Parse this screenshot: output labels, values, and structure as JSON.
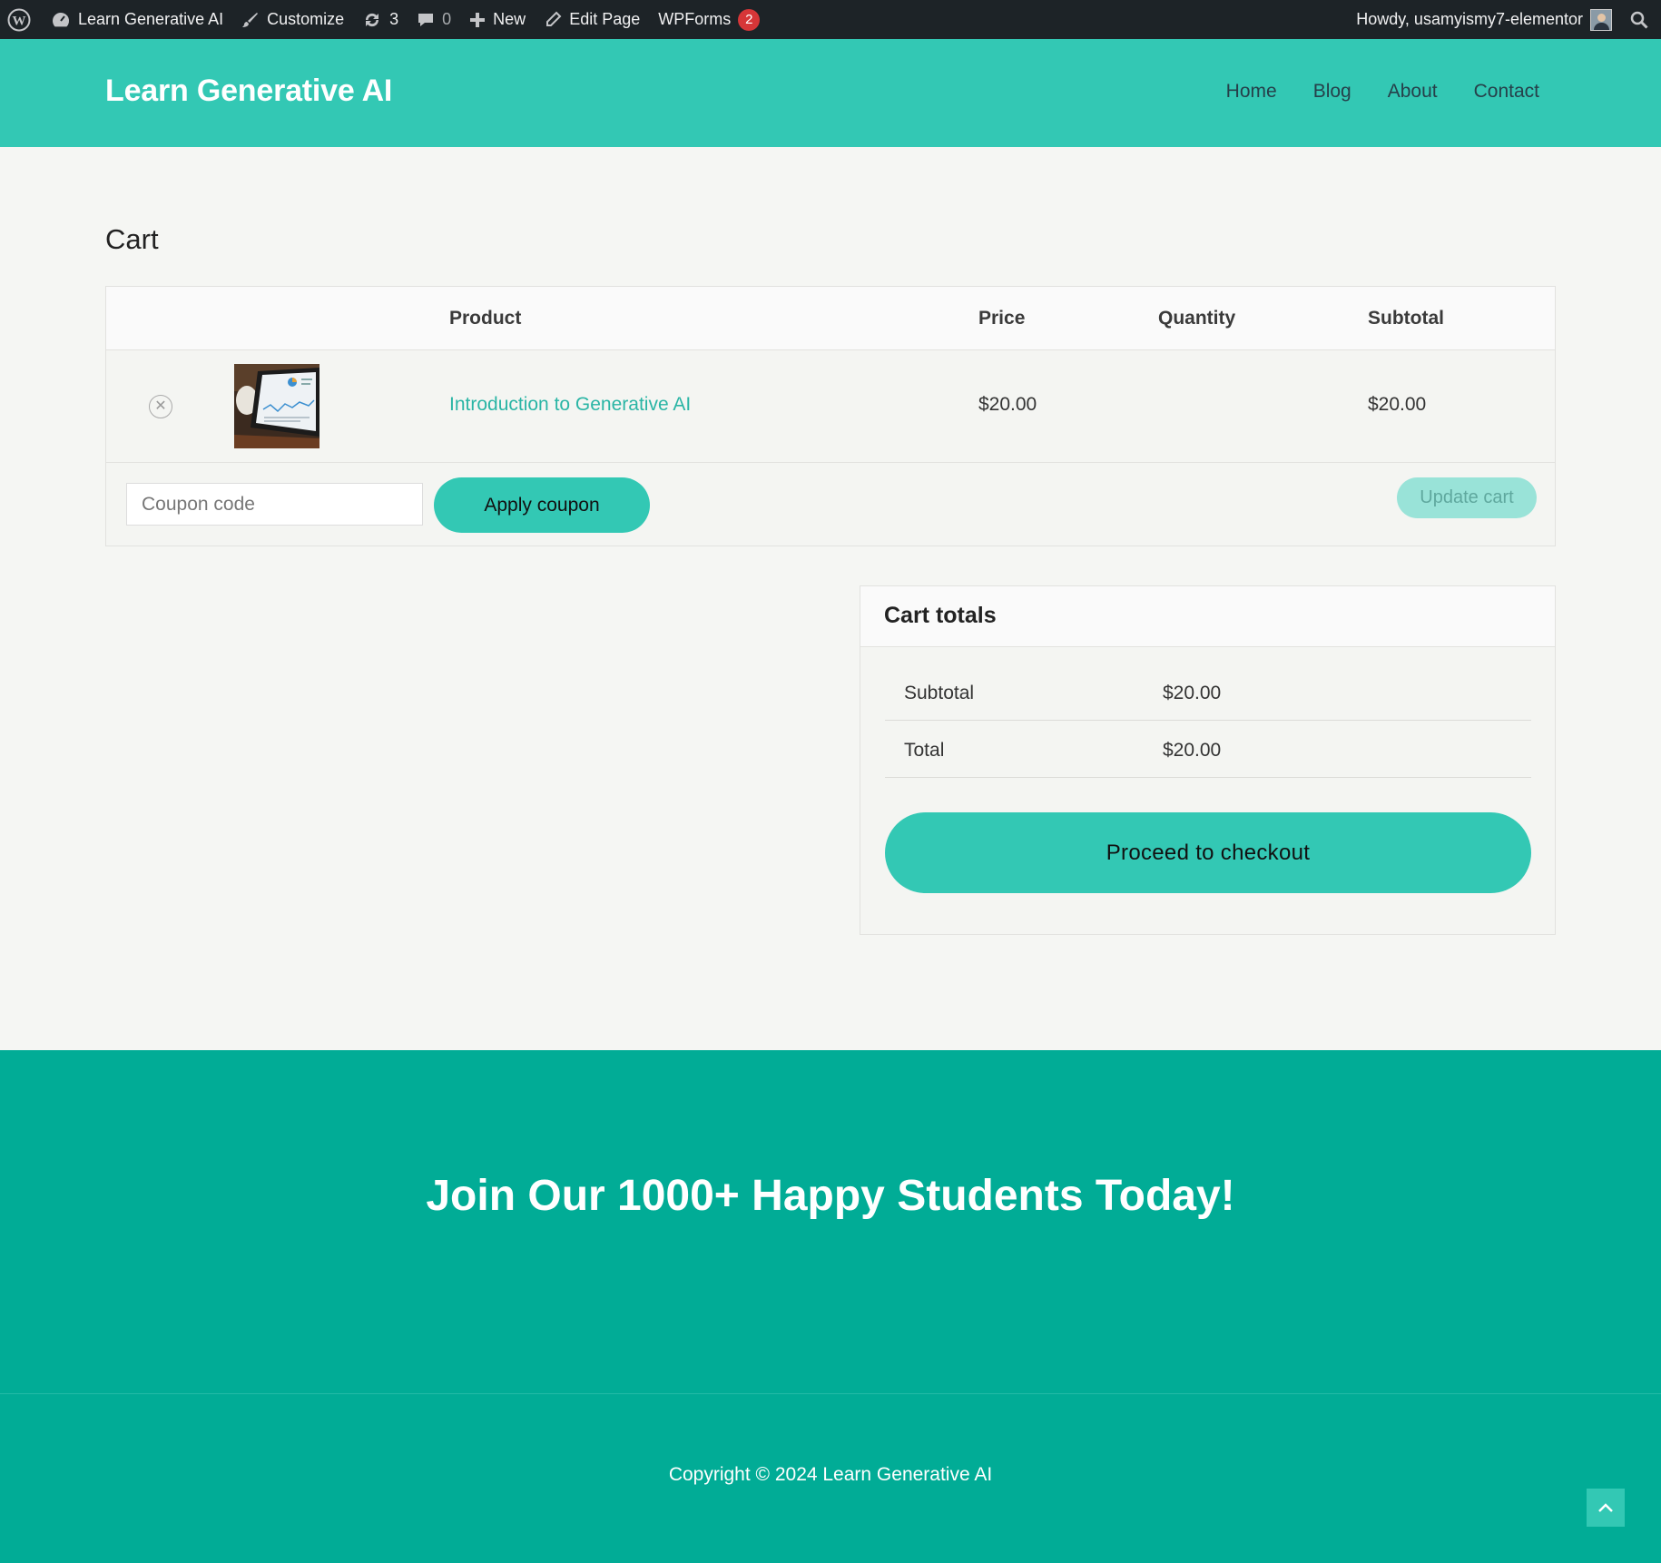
{
  "admin_bar": {
    "site_name": "Learn Generative AI",
    "customize": "Customize",
    "updates_count": "3",
    "comments_count": "0",
    "new": "New",
    "edit_page": "Edit Page",
    "wpforms": "WPForms",
    "wpforms_badge": "2",
    "howdy": "Howdy, usamyismy7-elementor"
  },
  "header": {
    "site_title": "Learn Generative AI",
    "nav": [
      "Home",
      "Blog",
      "About",
      "Contact"
    ]
  },
  "page": {
    "title": "Cart"
  },
  "cart": {
    "columns": [
      "Product",
      "Price",
      "Quantity",
      "Subtotal"
    ],
    "items": [
      {
        "name": "Introduction to Generative AI",
        "price": "$20.00",
        "subtotal": "$20.00"
      }
    ],
    "coupon_placeholder": "Coupon code",
    "apply_coupon": "Apply coupon",
    "update_cart": "Update cart"
  },
  "totals": {
    "title": "Cart totals",
    "rows": [
      {
        "label": "Subtotal",
        "value": "$20.00"
      },
      {
        "label": "Total",
        "value": "$20.00"
      }
    ],
    "checkout": "Proceed to checkout"
  },
  "cta": {
    "heading": "Join Our 1000+ Happy Students Today!"
  },
  "footer": {
    "copyright": "Copyright © 2024 Learn Generative AI"
  },
  "colors": {
    "brand": "#33c8b4",
    "footer": "#01ac96",
    "admin_bar": "#1d2327",
    "link": "#2ab5a5"
  }
}
